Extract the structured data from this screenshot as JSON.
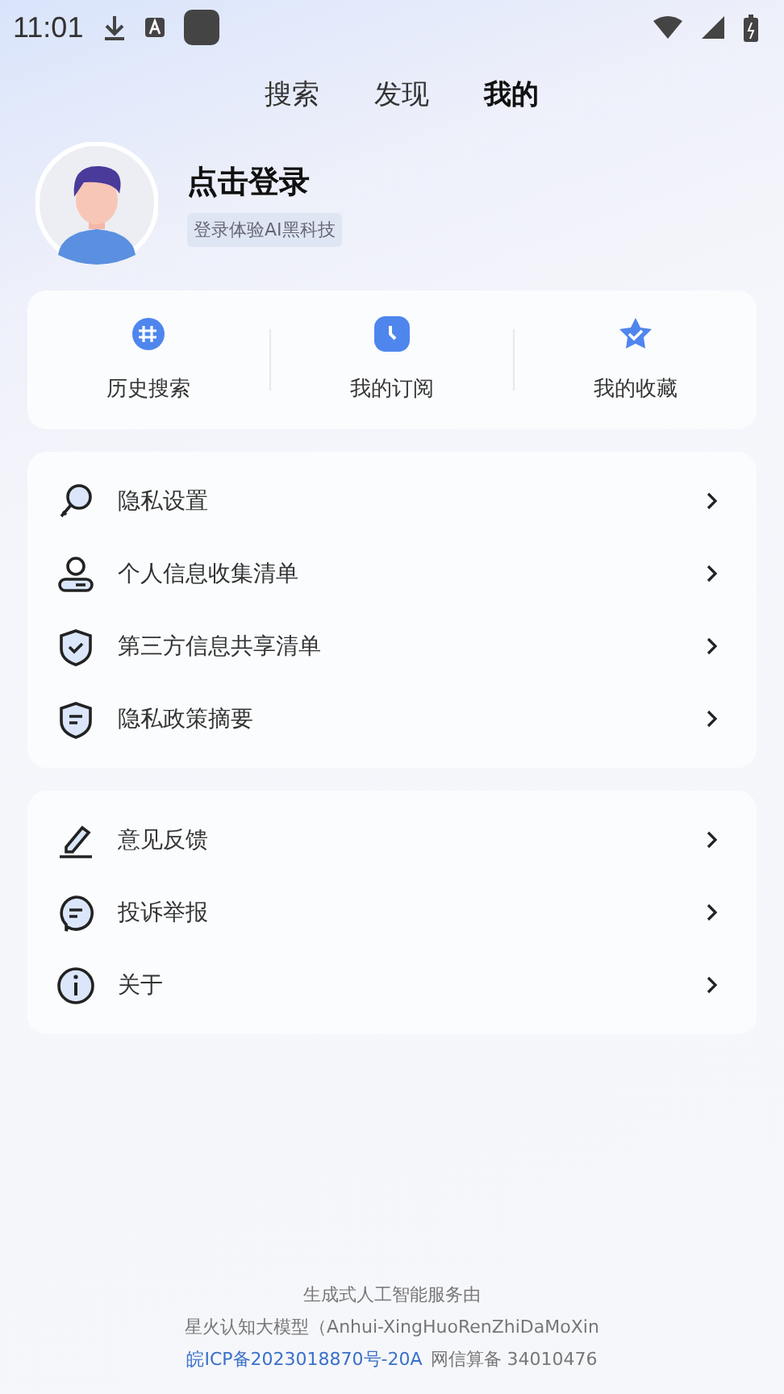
{
  "status_bar": {
    "time": "11:01"
  },
  "tabs": [
    {
      "label": "搜索",
      "selected": false
    },
    {
      "label": "发现",
      "selected": false
    },
    {
      "label": "我的",
      "selected": true
    }
  ],
  "profile": {
    "name": "点击登录",
    "tag": "登录体验AI黑科技"
  },
  "shortcuts": [
    {
      "label": "历史搜索",
      "kind": "hash"
    },
    {
      "label": "我的订阅",
      "kind": "clock"
    },
    {
      "label": "我的收藏",
      "kind": "star"
    }
  ],
  "menu_groups": [
    [
      {
        "label": "隐私设置",
        "kind": "key"
      },
      {
        "label": "个人信息收集清单",
        "kind": "person"
      },
      {
        "label": "第三方信息共享清单",
        "kind": "shield-check"
      },
      {
        "label": "隐私政策摘要",
        "kind": "shield-doc"
      }
    ],
    [
      {
        "label": "意见反馈",
        "kind": "pen"
      },
      {
        "label": "投诉举报",
        "kind": "chat"
      },
      {
        "label": "关于",
        "kind": "info"
      }
    ]
  ],
  "footer": {
    "line1": "生成式人工智能服务由",
    "line2": "星火认知大模型（Anhui-XingHuoRenZhiDaMoXin",
    "icp_link": "皖ICP备2023018870号-20A",
    "line3": "网信算备 34010476"
  }
}
